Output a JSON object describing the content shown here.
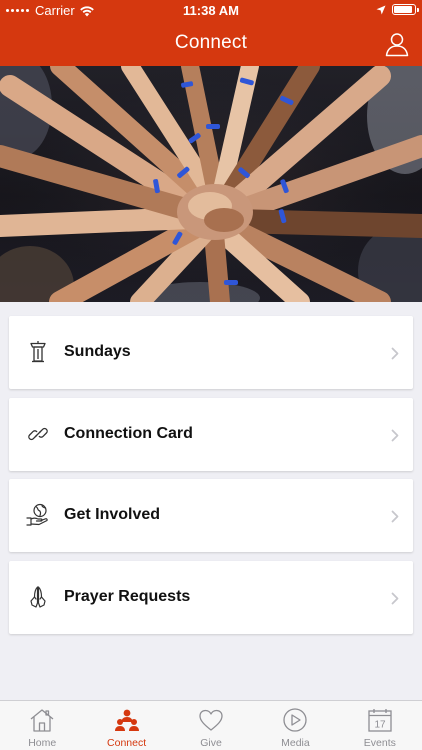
{
  "status_bar": {
    "carrier": "Carrier",
    "time": "11:38 AM",
    "battery_level": 0.95
  },
  "nav": {
    "title": "Connect",
    "profile_icon": "person-icon"
  },
  "hero": {
    "description_icon": "hands-together-photo"
  },
  "cards": [
    {
      "label": "Sundays",
      "icon": "pulpit-icon"
    },
    {
      "label": "Connection Card",
      "icon": "link-icon"
    },
    {
      "label": "Get Involved",
      "icon": "globe-hand-icon"
    },
    {
      "label": "Prayer Requests",
      "icon": "praying-hands-icon"
    }
  ],
  "tabs": [
    {
      "label": "Home",
      "icon": "house-icon",
      "active": false
    },
    {
      "label": "Connect",
      "icon": "people-icon",
      "active": true
    },
    {
      "label": "Give",
      "icon": "heart-icon",
      "active": false
    },
    {
      "label": "Media",
      "icon": "play-icon",
      "active": false
    },
    {
      "label": "Events",
      "icon": "calendar-icon",
      "active": false,
      "calendar_day": "17"
    }
  ],
  "colors": {
    "brand": "#d5380f",
    "background": "#efeff4",
    "tab_inactive": "#8e8e93"
  }
}
